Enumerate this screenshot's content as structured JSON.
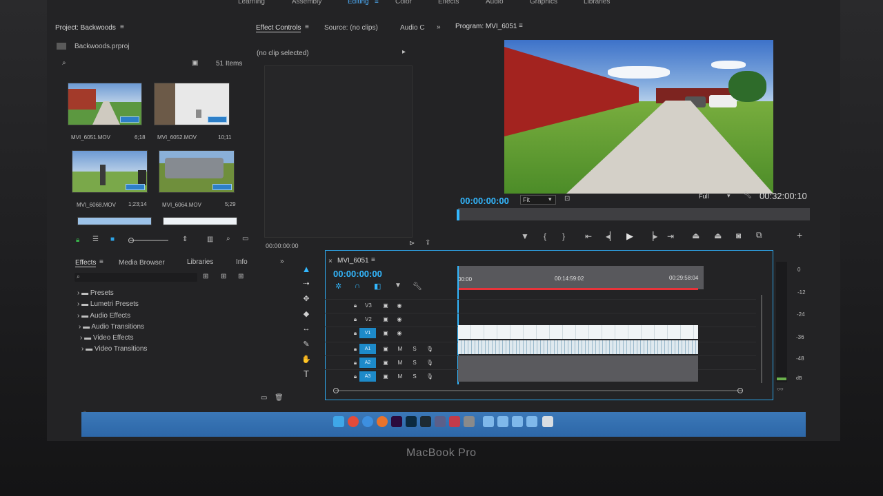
{
  "workspace_tabs": [
    "Learning",
    "Assembly",
    "Editing",
    "Color",
    "Effects",
    "Audio",
    "Graphics",
    "Libraries"
  ],
  "active_workspace": "Editing",
  "project": {
    "title": "Project: Backwoods",
    "file": "Backwoods.prproj",
    "item_count": "51 Items",
    "clips": [
      {
        "name": "MVI_6051.MOV",
        "duration": "6;18"
      },
      {
        "name": "MVI_6052.MOV",
        "duration": "10;11"
      },
      {
        "name": "MVI_6068.MOV",
        "duration": "1;23;14"
      },
      {
        "name": "MVI_6064.MOV",
        "duration": "5;29"
      }
    ]
  },
  "source_panel": {
    "tabs": [
      "Effect Controls",
      "Source: (no clips)",
      "Audio C"
    ],
    "message": "(no clip selected)",
    "timecode": "00:00:00:00"
  },
  "program_monitor": {
    "title": "Program: MVI_6051",
    "timecode": "00:00:00:00",
    "zoom": "Fit",
    "quality": "Full",
    "duration": "00:32:00:10"
  },
  "effects_panel": {
    "tabs": [
      "Effects",
      "Media Browser",
      "Libraries",
      "Info"
    ],
    "folders": [
      "Presets",
      "Lumetri Presets",
      "Audio Effects",
      "Audio Transitions",
      "Video Effects",
      "Video Transitions"
    ]
  },
  "timeline": {
    "sequence": "MVI_6051",
    "timecode": "00:00:00:00",
    "ruler": [
      "00:00",
      "00:14:59:02",
      "00:29:58:04"
    ],
    "tracks": [
      {
        "id": "V3",
        "kind": "video"
      },
      {
        "id": "V2",
        "kind": "video"
      },
      {
        "id": "V1",
        "kind": "video"
      },
      {
        "id": "A1",
        "kind": "audio"
      },
      {
        "id": "A2",
        "kind": "audio"
      },
      {
        "id": "A3",
        "kind": "audio"
      }
    ],
    "audio_buttons": [
      "M",
      "S"
    ]
  },
  "meter_scale": [
    "0",
    "-12",
    "-24",
    "-36",
    "-48",
    "dB"
  ],
  "laptop_label": "MacBook Pro",
  "colors": {
    "accent": "#33b8ff",
    "track_active": "#1d8ac9",
    "playhead": "#e8333a"
  }
}
